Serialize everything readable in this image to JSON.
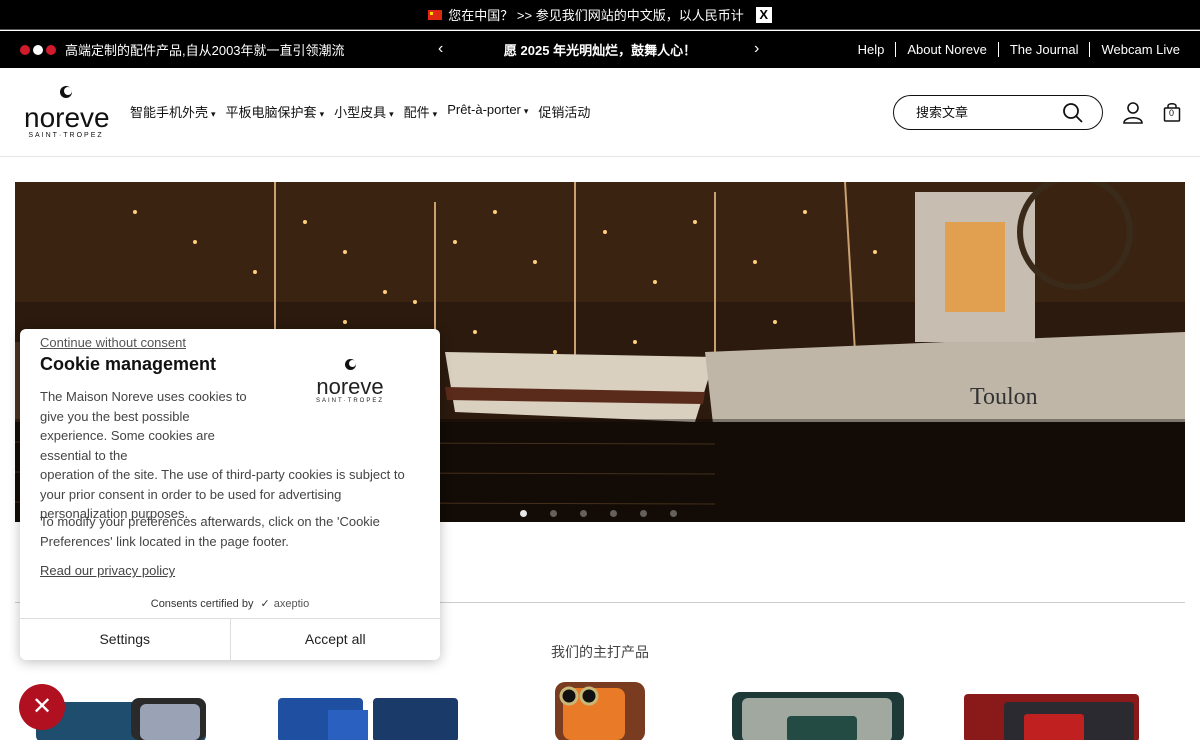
{
  "topbar": {
    "message": "您在中国？ >> 参见我们网站的中文版，以人民币计",
    "close_label": "X"
  },
  "subbar": {
    "tagline": "高端定制的配件产品,自从2003年就一直引领潮流",
    "promo": "愿 2025 年光明灿烂，鼓舞人心！",
    "prev_arrow": "‹",
    "next_arrow": "›",
    "links": [
      "Help",
      "About Noreve",
      "The Journal",
      "Webcam Live"
    ],
    "dot_colors": [
      "#d21b2a",
      "#ffffff",
      "#d21b2a"
    ]
  },
  "header": {
    "logo_word": "noreve",
    "logo_sub": "SAINT·TROPEZ",
    "nav": [
      {
        "label": "智能手机外壳",
        "has_menu": true
      },
      {
        "label": "平板电脑保护套",
        "has_menu": true
      },
      {
        "label": "小型皮具",
        "has_menu": true
      },
      {
        "label": "配件",
        "has_menu": true
      },
      {
        "label": "Prêt-à-porter",
        "has_menu": true
      },
      {
        "label": "促销活动",
        "has_menu": false
      }
    ],
    "caret": "▾",
    "search_placeholder": "搜索文章",
    "cart_count": "0"
  },
  "hero": {
    "pager_count": 6,
    "active_index": 0
  },
  "main": {
    "section_title": "我们的主打产品"
  },
  "cookie": {
    "skip_label": "Continue without consent",
    "title": "Cookie management",
    "body_1a": "The Maison Noreve uses cookies to give you the best possible experience. Some cookies are essential to the",
    "body_1b": "operation of the site. The use of third-party cookies is subject to your prior consent in order to be used for advertising personalization purposes.",
    "body_2": "To modify your preferences afterwards, click on the 'Cookie Preferences' link located in the page footer.",
    "privacy_label": "Read our privacy policy",
    "certified_label": "Consents certified by",
    "certifier": "axeptio",
    "settings_label": "Settings",
    "accept_label": "Accept all",
    "logo_word": "noreve",
    "logo_sub": "SAINT·TROPEZ"
  },
  "fab": {
    "icon": "close-icon",
    "glyph": "✕",
    "color": "#b01020"
  },
  "colors": {
    "accent": "#000000",
    "fab": "#b01020"
  }
}
